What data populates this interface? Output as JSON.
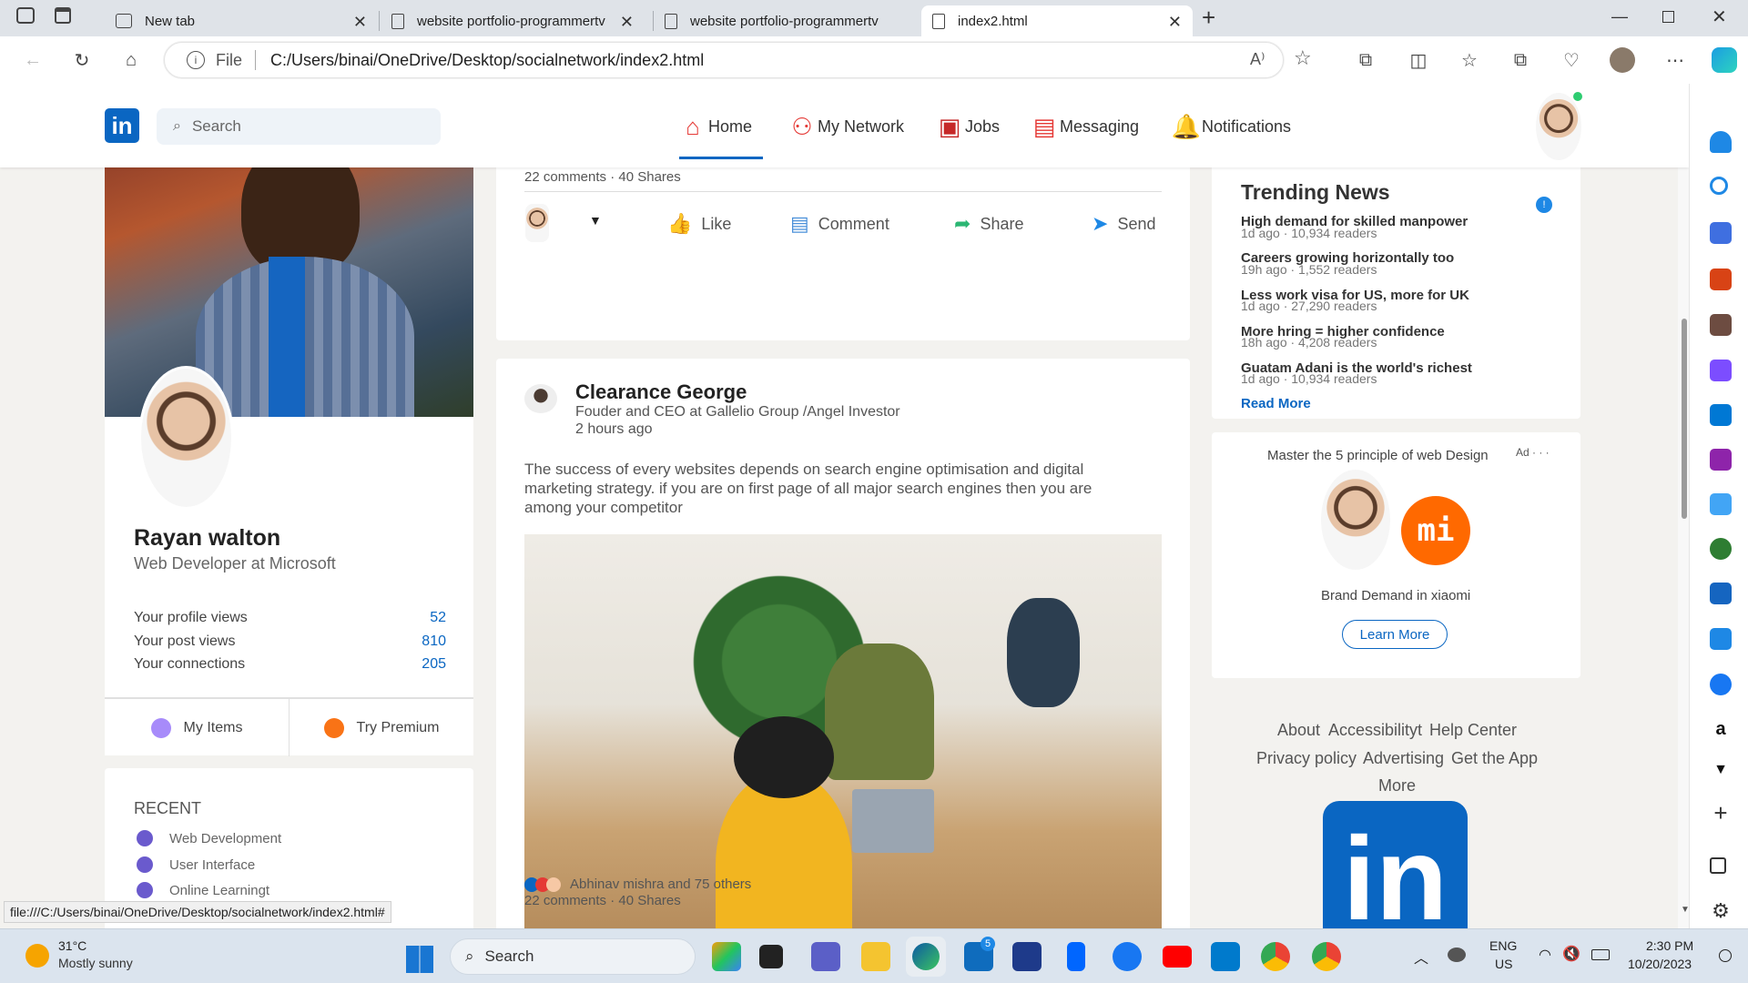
{
  "browser": {
    "tabs": [
      {
        "title": "New tab"
      },
      {
        "title": "website portfolio-programmertv"
      },
      {
        "title": "website portfolio-programmertv"
      },
      {
        "title": "index2.html"
      }
    ],
    "address": {
      "scheme_label": "File",
      "url": "C:/Users/binai/OneDrive/Desktop/socialnetwork/index2.html"
    },
    "status_url": "file:///C:/Users/binai/OneDrive/Desktop/socialnetwork/index2.html#"
  },
  "nav": {
    "logo": "in",
    "search_placeholder": "Search",
    "items": [
      {
        "label": "Home",
        "icon": "home-icon"
      },
      {
        "label": "My Network",
        "icon": "network-icon"
      },
      {
        "label": "Jobs",
        "icon": "briefcase-icon"
      },
      {
        "label": "Messaging",
        "icon": "message-icon"
      },
      {
        "label": "Notifications",
        "icon": "bell-icon"
      }
    ]
  },
  "profile": {
    "name": "Rayan walton",
    "headline": "Web Developer at Microsoft",
    "stats": [
      {
        "label": "Your profile views",
        "value": "52"
      },
      {
        "label": "Your post views",
        "value": "810"
      },
      {
        "label": "Your connections",
        "value": "205"
      }
    ],
    "buttons": [
      {
        "label": "My Items"
      },
      {
        "label": "Try Premium"
      }
    ],
    "recent_title": "RECENT",
    "recent": [
      "Web Development",
      "User Interface",
      "Online Learningt"
    ]
  },
  "post1": {
    "meta": "22 comments · 40 Shares",
    "actions": [
      "Like",
      "Comment",
      "Share",
      "Send"
    ]
  },
  "post2": {
    "author": "Clearance George",
    "title": "Fouder and CEO at Gallelio Group /Angel Investor",
    "time": "2 hours ago",
    "text": "The success of every websites depends on search engine optimisation and digital marketing strategy. if you are on first page of all major search engines then you are among your competitor",
    "reactions": "Abhinav mishra and 75 others",
    "meta": "22 comments · 40 Shares"
  },
  "news": {
    "title": "Trending News",
    "items": [
      {
        "headline": "High demand for skilled manpower",
        "sub": "1d ago · 10,934 readers"
      },
      {
        "headline": "Careers growing horizontally too",
        "sub": "19h ago · 1,552 readers"
      },
      {
        "headline": "Less work visa for US, more for UK",
        "sub": "1d ago · 27,290 readers"
      },
      {
        "headline": "More hring = higher confidence",
        "sub": "18h ago · 4,208 readers"
      },
      {
        "headline": "Guatam Adani is the world's richest",
        "sub": "1d ago · 10,934 readers"
      }
    ],
    "read_more": "Read More"
  },
  "ad": {
    "title": "Master the 5 principle of web Design",
    "label": "Ad · · ·",
    "brand": "Brand Demand in xiaomi",
    "brand_logo": "mi",
    "button": "Learn More"
  },
  "footer": {
    "links": [
      "About",
      "Accessibilityt",
      "Help Center",
      "Privacy policy",
      "Advertising",
      "Get the App",
      "More"
    ]
  },
  "taskbar": {
    "weather": {
      "temp": "31°C",
      "desc": "Mostly sunny"
    },
    "search": "Search",
    "lang": "ENG",
    "region": "US",
    "time": "2:30 PM",
    "date": "10/20/2023",
    "badge": "5"
  }
}
